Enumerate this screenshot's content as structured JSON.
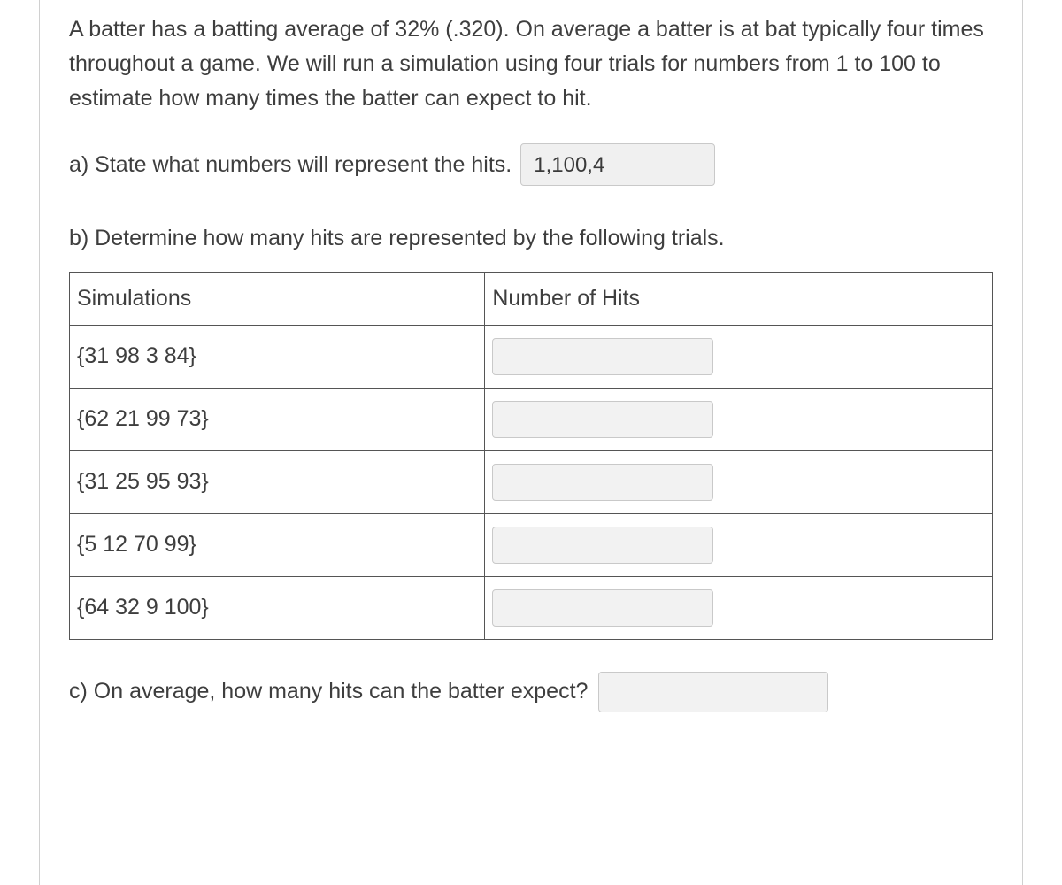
{
  "problem_text": "A batter has a batting average of 32% (.320).  On average a batter is at bat typically four times throughout a game.  We will run a simulation using four trials for numbers from 1 to 100 to estimate how many times the batter can expect to hit.",
  "part_a": {
    "label": "a) State what numbers will represent the hits.",
    "value": "1,100,4"
  },
  "part_b": {
    "label": "b) Determine how many hits are represented by the following trials.",
    "headers": {
      "simulations": "Simulations",
      "hits": "Number of Hits"
    },
    "rows": [
      {
        "sim": "{31 98 3 84}",
        "hits": ""
      },
      {
        "sim": "{62 21 99 73}",
        "hits": ""
      },
      {
        "sim": "{31 25 95 93}",
        "hits": ""
      },
      {
        "sim": "{5 12 70 99}",
        "hits": ""
      },
      {
        "sim": "{64 32 9 100}",
        "hits": ""
      }
    ]
  },
  "part_c": {
    "label": "c) On average, how many hits can the batter expect?",
    "value": ""
  }
}
